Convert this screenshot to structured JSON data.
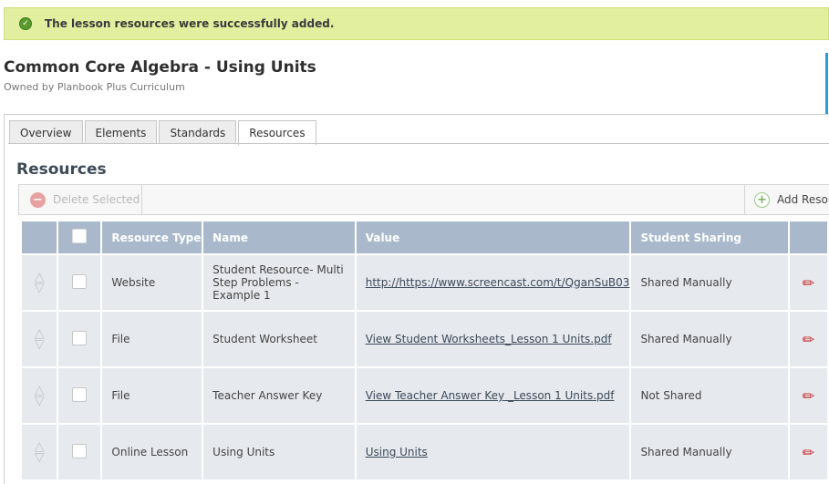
{
  "banner": {
    "message": "The lesson resources were successfully added.",
    "icon": "check-circle-icon",
    "color": "#e1ef9e"
  },
  "lesson": {
    "title": "Common Core Algebra - Using Units",
    "owner": "Owned by Planbook Plus Curriculum"
  },
  "tabs": [
    {
      "label": "Overview",
      "active": false
    },
    {
      "label": "Elements",
      "active": false
    },
    {
      "label": "Standards",
      "active": false
    },
    {
      "label": "Resources",
      "active": true
    }
  ],
  "section": {
    "heading": "Resources"
  },
  "toolbar": {
    "delete_label": "Delete Selected",
    "add_label": "Add Resou"
  },
  "table": {
    "headers": [
      "Resource Type",
      "Name",
      "Value",
      "Student Sharing"
    ],
    "rows": [
      {
        "type": "Website",
        "name": "Student Resource- Multi Step Problems - Example 1",
        "value": "http://https://www.screencast.com/t/QganSuB03",
        "sharing": "Shared Manually"
      },
      {
        "type": "File",
        "name": "Student Worksheet",
        "value": "View Student Worksheets_Lesson 1 Units.pdf",
        "sharing": "Shared Manually"
      },
      {
        "type": "File",
        "name": "Teacher Answer Key",
        "value": "View Teacher Answer Key _Lesson 1 Units.pdf",
        "sharing": "Not Shared"
      },
      {
        "type": "Online Lesson",
        "name": "Using Units",
        "value": "Using Units",
        "sharing": "Shared Manually"
      }
    ]
  },
  "colors": {
    "header": "#a9b9cb",
    "row": "#e6e9ed",
    "accent": "#2a9dd8",
    "edit_icon": "#c92a2a"
  }
}
